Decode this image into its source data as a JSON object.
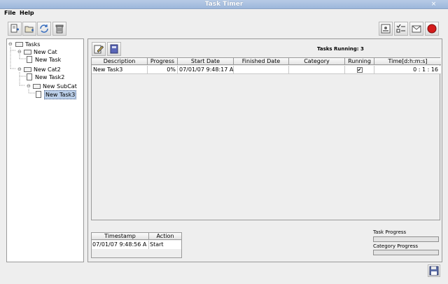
{
  "window": {
    "title": "Task Timer",
    "close_glyph": "×"
  },
  "menu": {
    "file": "File",
    "help": "Help"
  },
  "toolbar": {
    "left_buttons": [
      "new-task-icon",
      "new-category-icon",
      "refresh-icon",
      "trash-icon"
    ],
    "right_buttons": [
      "report-icon",
      "checklist-icon",
      "mail-icon",
      "stop-icon"
    ]
  },
  "tree": {
    "root": "Tasks",
    "items": [
      "New Cat",
      "New Task",
      "New Cat2",
      "New Task2",
      "New SubCat",
      "New Task3"
    ],
    "selected": "New Task3"
  },
  "main": {
    "tasks_running_label": "Tasks Running:",
    "tasks_running_count": "3",
    "columns": [
      "Description",
      "Progress",
      "Start Date",
      "Finished Date",
      "Category",
      "Running",
      "Time[d:h:m:s]"
    ],
    "rows": [
      {
        "description": "New Task3",
        "progress": "0%",
        "start_date": "07/01/07 9:48:17 A",
        "finished_date": "",
        "category": "",
        "running": true,
        "time": "0 : 1 : 16"
      }
    ]
  },
  "log": {
    "columns": [
      "Timestamp",
      "Action"
    ],
    "rows": [
      {
        "timestamp": "07/01/07 9:48:56 A",
        "action": "Start"
      }
    ]
  },
  "progress": {
    "task_label": "Task Progress",
    "task_value": 0,
    "category_label": "Category Progress",
    "category_value": 0
  },
  "colors": {
    "titlebar": "#9db7db",
    "selection": "#bcd0ea",
    "stop": "#d41c1c"
  }
}
